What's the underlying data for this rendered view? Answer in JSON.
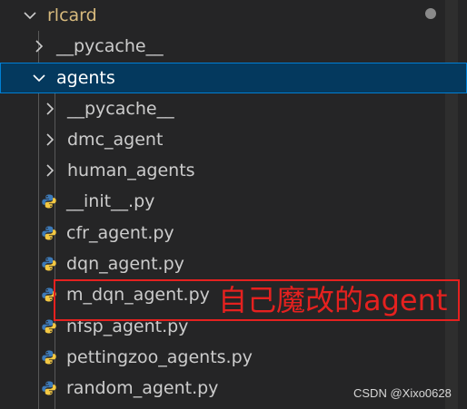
{
  "tree": {
    "root": {
      "label": "rlcard",
      "expanded": true,
      "icon": "chevron-down-icon"
    },
    "items": [
      {
        "label": "__pycache__",
        "type": "folder",
        "expanded": false,
        "icon": "chevron-right-icon"
      },
      {
        "label": "agents",
        "type": "folder",
        "expanded": true,
        "selected": true,
        "icon": "chevron-down-icon"
      },
      {
        "label": "__pycache__",
        "type": "folder",
        "expanded": false,
        "icon": "chevron-right-icon"
      },
      {
        "label": "dmc_agent",
        "type": "folder",
        "expanded": false,
        "icon": "chevron-right-icon"
      },
      {
        "label": "human_agents",
        "type": "folder",
        "expanded": false,
        "icon": "chevron-right-icon"
      },
      {
        "label": "__init__.py",
        "type": "file",
        "icon": "python-icon"
      },
      {
        "label": "cfr_agent.py",
        "type": "file",
        "icon": "python-icon"
      },
      {
        "label": "dqn_agent.py",
        "type": "file",
        "icon": "python-icon"
      },
      {
        "label": "m_dqn_agent.py",
        "type": "file",
        "icon": "python-icon"
      },
      {
        "label": "nfsp_agent.py",
        "type": "file",
        "icon": "python-icon"
      },
      {
        "label": "pettingzoo_agents.py",
        "type": "file",
        "icon": "python-icon"
      },
      {
        "label": "random_agent.py",
        "type": "file",
        "icon": "python-icon"
      }
    ]
  },
  "annotation": {
    "text": "自己魔改的agent",
    "color": "#e5211f"
  },
  "watermark": "CSDN @Xixo0628",
  "colors": {
    "background": "#252526",
    "selection": "#04395e",
    "selection_border": "#007fd4",
    "text": "#cccccc",
    "root_text": "#d7ba7d",
    "python_blue": "#3d7ab8",
    "python_yellow": "#f3c843"
  }
}
